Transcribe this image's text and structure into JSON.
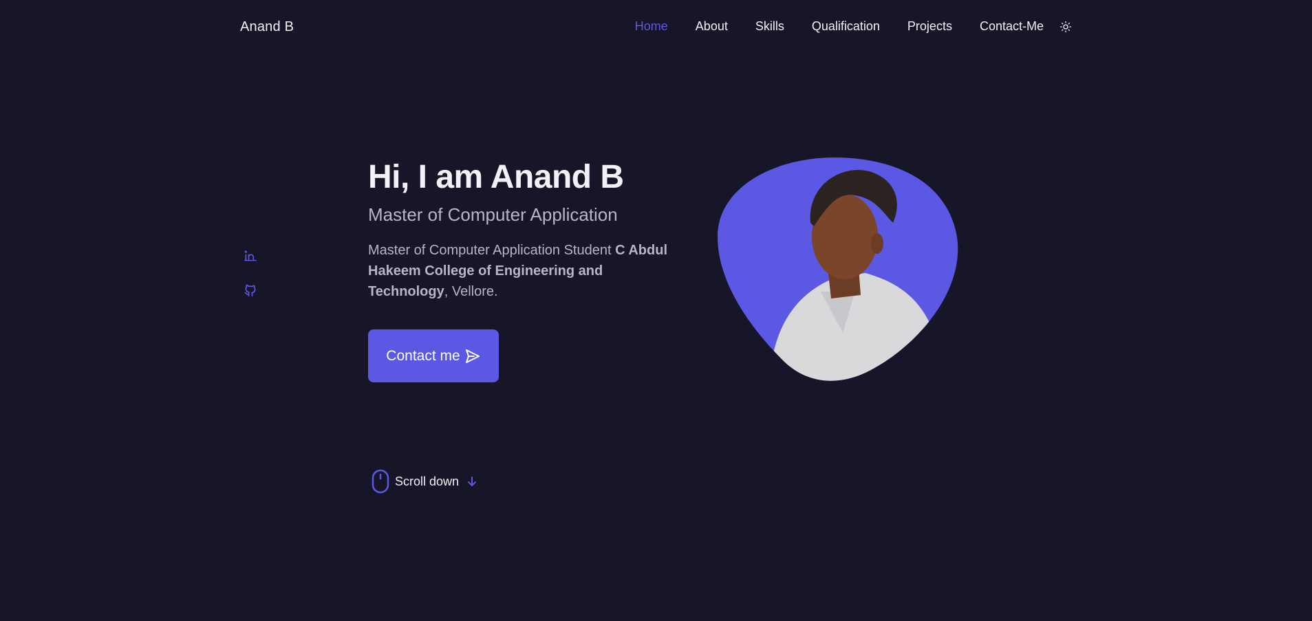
{
  "header": {
    "logo": "Anand B",
    "nav": [
      "Home",
      "About",
      "Skills",
      "Qualification",
      "Projects",
      "Contact-Me"
    ],
    "active_nav": "Home",
    "theme_toggle_icon": "sun-icon"
  },
  "social": {
    "icons": [
      "linkedin-icon",
      "github-icon"
    ]
  },
  "hero": {
    "title": "Hi, I am Anand B",
    "subtitle": "Master of Computer Application",
    "desc_prefix": "Master of Computer Application Student ",
    "desc_bold": "C Abdul Hakeem College of Engineering and Technology",
    "desc_suffix": ", Vellore.",
    "contact_button": "Contact me",
    "contact_icon": "send-icon"
  },
  "scroll": {
    "label": "Scroll down",
    "icon": "mouse-icon",
    "arrow_icon": "arrow-down-icon"
  },
  "colors": {
    "background": "#171628",
    "accent": "#5b58e4",
    "title_text": "#f2f1f7",
    "body_text": "#b7b6c9"
  }
}
